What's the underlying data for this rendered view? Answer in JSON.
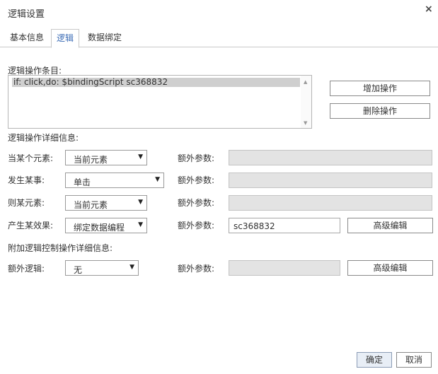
{
  "dialog": {
    "title": "逻辑设置",
    "close_glyph": "×"
  },
  "tabs": [
    {
      "label": "基本信息"
    },
    {
      "label": "逻辑"
    },
    {
      "label": "数据绑定"
    }
  ],
  "logic_items": {
    "label": "逻辑操作条目:",
    "items": [
      "if: click,do: $bindingScript sc368832"
    ],
    "add_button": "增加操作",
    "delete_button": "删除操作"
  },
  "detail": {
    "section_label": "逻辑操作详细信息:",
    "extra_param_label": "额外参数:",
    "rows": [
      {
        "label": "当某个元素:",
        "select_value": "当前元素",
        "param_value": ""
      },
      {
        "label": "发生某事:",
        "select_value": "单击",
        "param_value": ""
      },
      {
        "label": "则某元素:",
        "select_value": "当前元素",
        "param_value": ""
      },
      {
        "label": "产生某效果:",
        "select_value": "绑定数据编程",
        "param_value": "sc368832",
        "advanced_button": "高级编辑"
      }
    ]
  },
  "additional": {
    "section_label": "附加逻辑控制操作详细信息:",
    "row_label": "额外逻辑:",
    "select_value": "无",
    "extra_param_label": "额外参数:",
    "param_value": "",
    "advanced_button": "高级编辑"
  },
  "footer": {
    "ok_button": "确定",
    "cancel_button": "取消"
  },
  "icons": {
    "dropdown_arrow": "chevron-down-icon",
    "scroll_up": "scroll-up-icon",
    "scroll_down": "scroll-down-icon"
  }
}
